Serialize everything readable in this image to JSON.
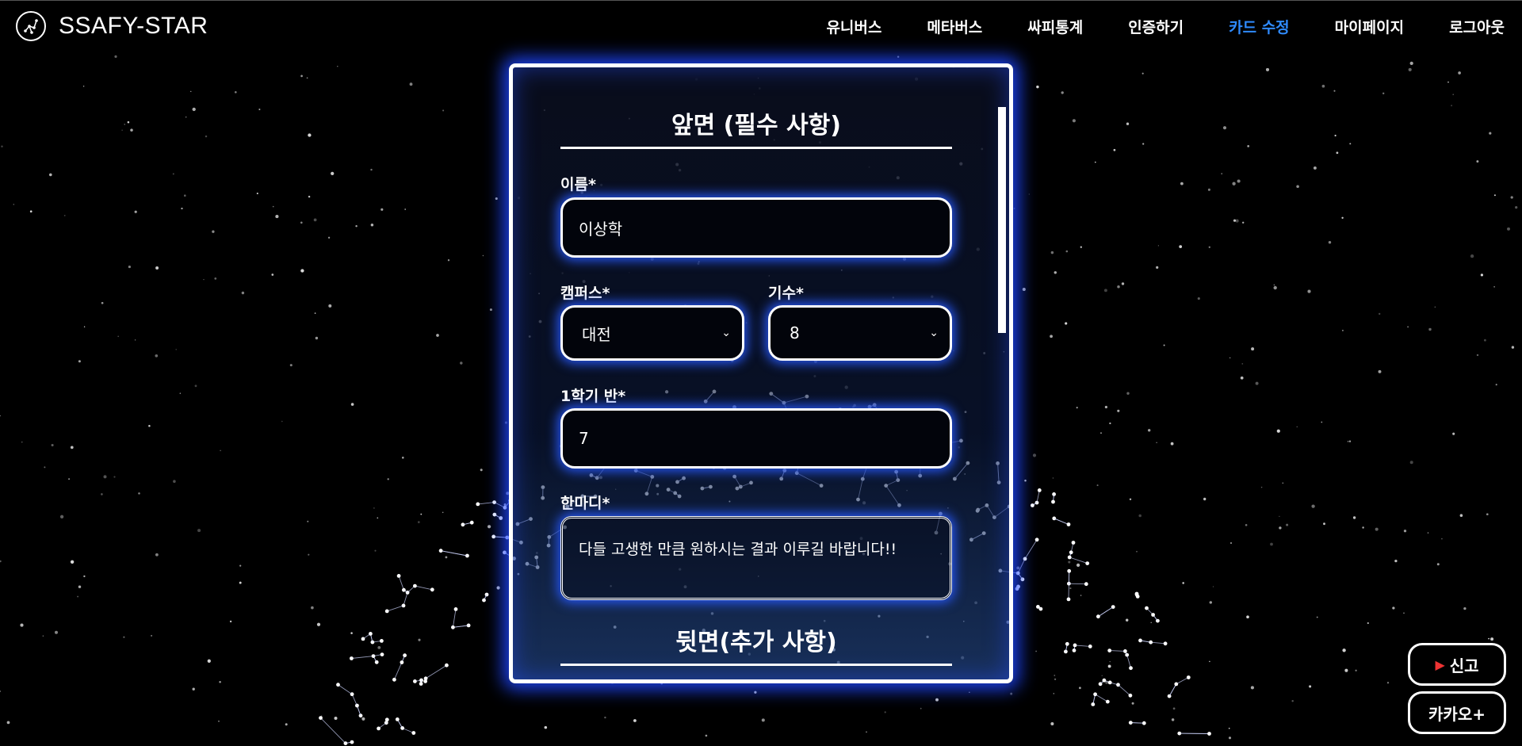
{
  "navbar": {
    "logo_text": "SSAFY-STAR",
    "items": [
      "유니버스",
      "메타버스",
      "싸피통계",
      "인증하기",
      "카드 수정",
      "마이페이지",
      "로그아웃"
    ],
    "active_index": 4
  },
  "form": {
    "front_title": "앞면 (필수 사항)",
    "name_label": "이름*",
    "name_value": "이상학",
    "campus_label": "캠퍼스*",
    "campus_value": "대전",
    "generation_label": "기수*",
    "generation_value": "8",
    "class_label": "1학기 반*",
    "class_value": "7",
    "comment_label": "한마디*",
    "comment_value": "다들 고생한 만큼 원하시는 결과 이루길 바랍니다!!",
    "back_title": "뒷면(추가 사항)"
  },
  "floating": {
    "report_label": "신고",
    "report_icon": "megaphone-icon",
    "kakao_label": "카카오+"
  },
  "colors": {
    "background": "#000000",
    "accent": "#2f8bff",
    "glow": "#1e46ff"
  }
}
